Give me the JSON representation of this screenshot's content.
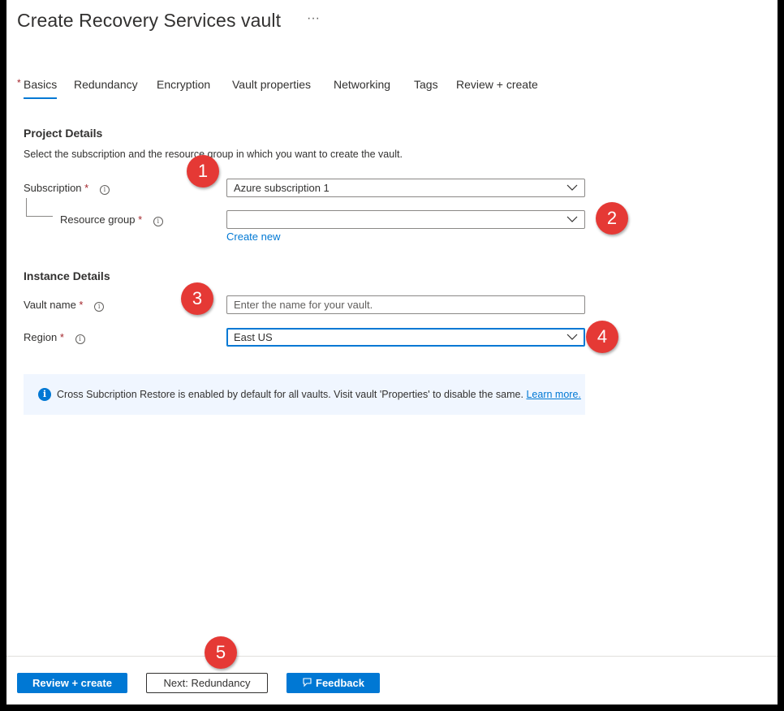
{
  "header": {
    "title": "Create Recovery Services vault",
    "more": "···"
  },
  "tabs": [
    {
      "label": "Basics",
      "required_marker": "*",
      "active": true
    },
    {
      "label": "Redundancy"
    },
    {
      "label": "Encryption"
    },
    {
      "label": "Vault properties"
    },
    {
      "label": "Networking"
    },
    {
      "label": "Tags"
    },
    {
      "label": "Review + create"
    }
  ],
  "project": {
    "title": "Project Details",
    "description": "Select the subscription and the resource group in which you want to create the vault.",
    "subscription": {
      "label": "Subscription",
      "required": "*",
      "value": "Azure subscription 1"
    },
    "resource_group": {
      "label": "Resource group",
      "required": "*",
      "value": "",
      "create_new": "Create new"
    }
  },
  "instance": {
    "title": "Instance Details",
    "vault_name": {
      "label": "Vault name",
      "required": "*",
      "placeholder": "Enter the name for your vault."
    },
    "region": {
      "label": "Region",
      "required": "*",
      "value": "East US"
    }
  },
  "infobar": {
    "text": "Cross Subcription Restore is enabled by default for all vaults. Visit vault 'Properties' to disable the same.",
    "link": "Learn more."
  },
  "footer": {
    "review_create": "Review + create",
    "next": "Next: Redundancy",
    "feedback": "Feedback"
  },
  "callouts": [
    "1",
    "2",
    "3",
    "4",
    "5"
  ],
  "colors": {
    "accent": "#0078d4",
    "callout": "#e53935",
    "required": "#a4262c"
  }
}
